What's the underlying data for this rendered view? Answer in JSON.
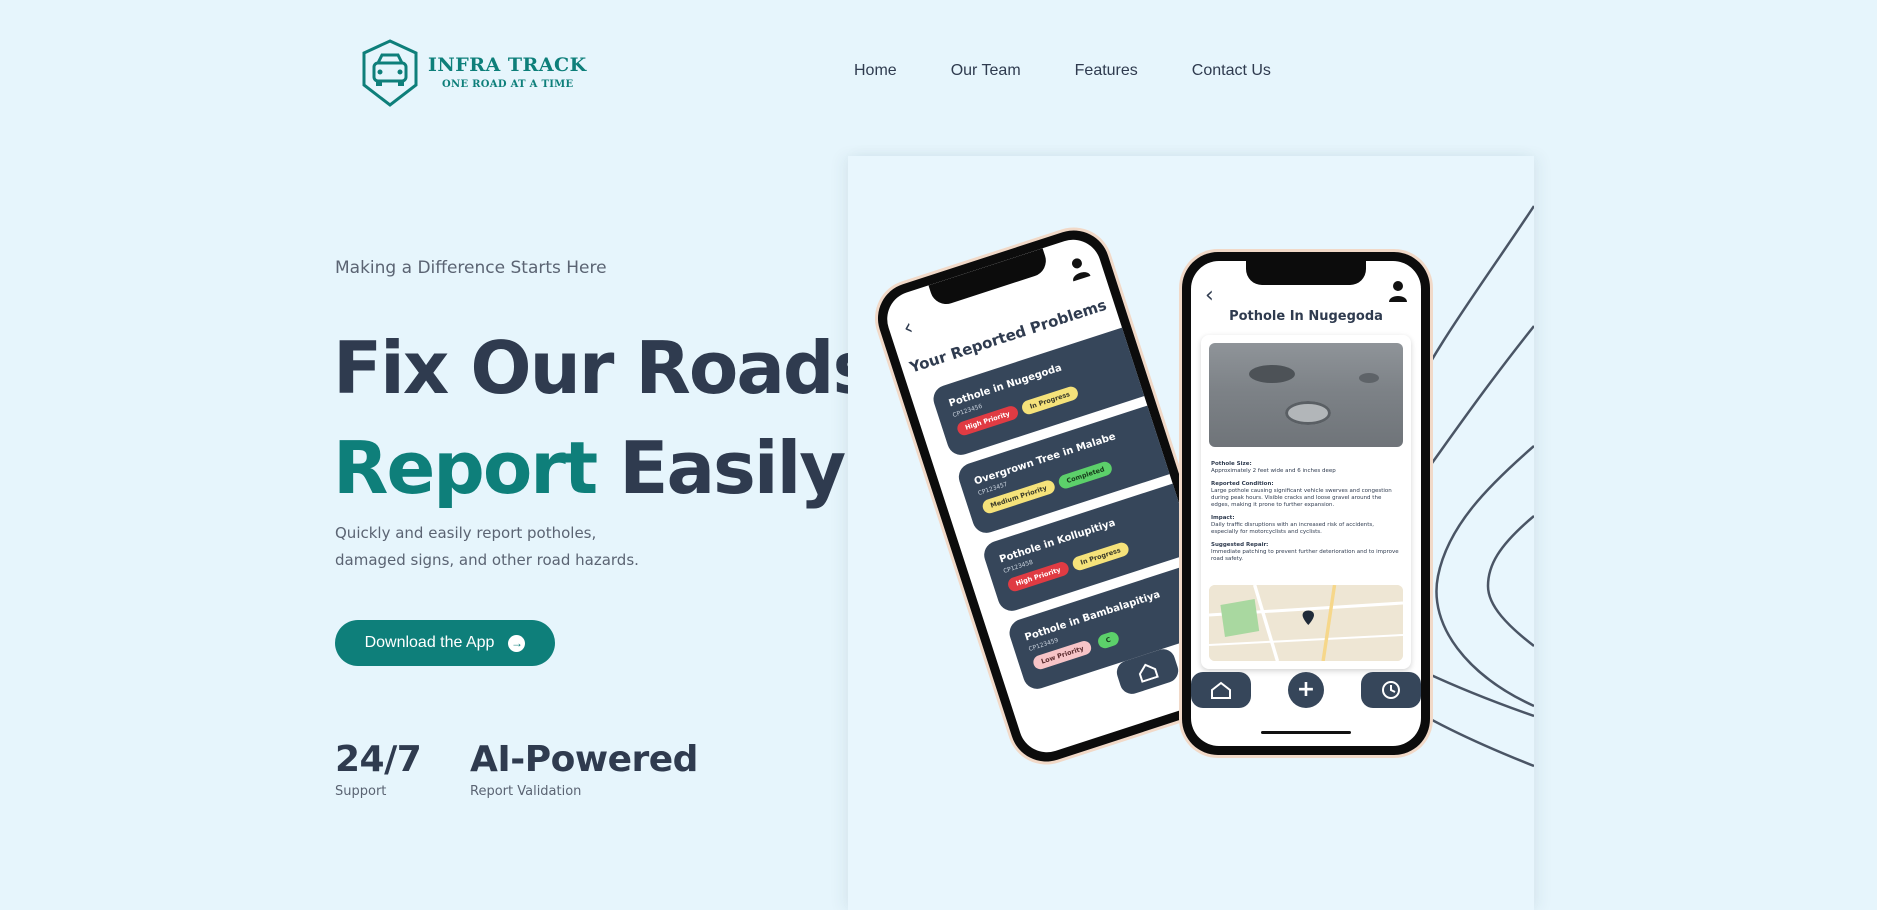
{
  "brand": {
    "name": "INFRA TRACK",
    "tagline": "ONE ROAD AT A TIME",
    "accent_color": "#0e7f7a",
    "text_color": "#2f3b4f"
  },
  "nav": {
    "items": [
      {
        "label": "Home"
      },
      {
        "label": "Our Team"
      },
      {
        "label": "Features"
      },
      {
        "label": "Contact Us"
      }
    ]
  },
  "hero": {
    "eyebrow": "Making a Difference Starts Here",
    "headline_line1": "Fix Our Roads",
    "headline_accent": "Report",
    "headline_line2_rest": "Easily",
    "subtitle": "Quickly and easily report potholes, damaged signs, and other road hazards.",
    "cta_label": "Download the App",
    "cta_icon": "arrow-right-circle-icon"
  },
  "stats": [
    {
      "value": "24/7",
      "label": "Support"
    },
    {
      "value": "AI-Powered",
      "label": "Report Validation"
    }
  ],
  "phone_list": {
    "title": "Your Reported Problems",
    "problems": [
      {
        "title": "Pothole in Nugegoda",
        "id": "CP123456",
        "tags": [
          {
            "text": "High Priority",
            "color": "red"
          },
          {
            "text": "In Progress",
            "color": "yellow"
          }
        ]
      },
      {
        "title": "Overgrown Tree in Malabe",
        "id": "CP123457",
        "tags": [
          {
            "text": "Medium Priority",
            "color": "yellow"
          },
          {
            "text": "Completed",
            "color": "green"
          }
        ]
      },
      {
        "title": "Pothole in Kollupitiya",
        "id": "CP123458",
        "tags": [
          {
            "text": "High Priority",
            "color": "red"
          },
          {
            "text": "In Progress",
            "color": "yellow"
          }
        ]
      },
      {
        "title": "Pothole in Bambalapitiya",
        "id": "CP123459",
        "tags": [
          {
            "text": "Low Priority",
            "color": "pink"
          },
          {
            "text": "C",
            "color": "green"
          }
        ]
      }
    ]
  },
  "phone_detail": {
    "title": "Pothole In Nugegoda",
    "size_label": "Pothole Size:",
    "size_text": "Approximately 2 feet wide and 6 inches deep",
    "condition_label": "Reported Condition:",
    "condition_text": "Large pothole causing significant vehicle swerves and congestion during peak hours. Visible cracks and loose gravel around the edges, making it prone to further expansion.",
    "impact_label": "Impact:",
    "impact_text": "Daily traffic disruptions with an increased risk of accidents, especially for motorcyclists and cyclists.",
    "repair_label": "Suggested Repair:",
    "repair_text": "Immediate patching to prevent further deterioration and to improve road safety."
  }
}
